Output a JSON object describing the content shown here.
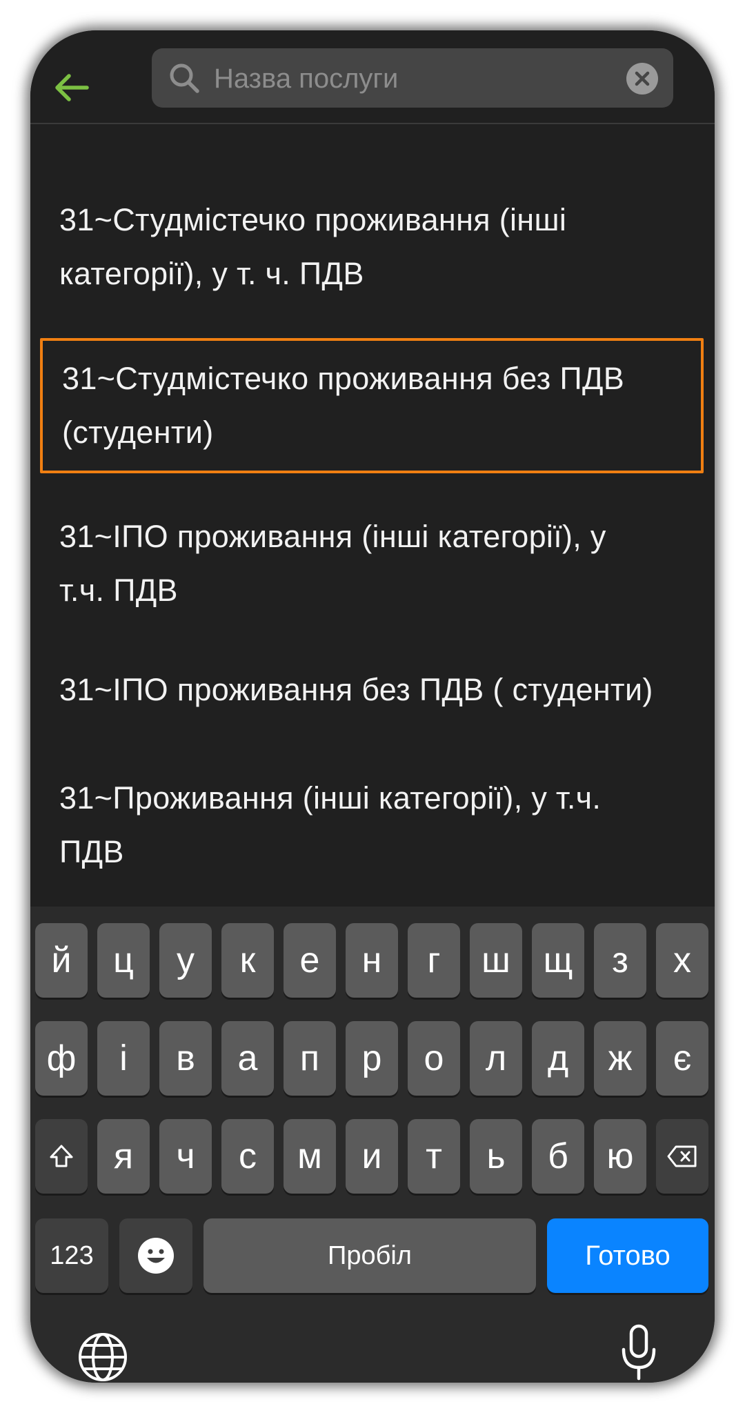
{
  "header": {
    "back_icon": "arrow-left-icon",
    "accent_color": "#7cc043",
    "search": {
      "placeholder": "Назва послуги",
      "value": ""
    }
  },
  "results": [
    {
      "line1": "31~Студмістечко проживання (інші",
      "line2": "категорії), у т. ч. ПДВ",
      "selected": false
    },
    {
      "line1": "31~Студмістечко проживання без ПДВ",
      "line2": "(студенти)",
      "selected": true
    },
    {
      "line1": "31~ІПО проживання (інші категорії), у",
      "line2": "т.ч. ПДВ",
      "selected": false
    },
    {
      "line1": "31~ІПО проживання без ПДВ ( студенти)",
      "line2": "",
      "selected": false
    },
    {
      "line1": "31~Проживання (інші категорії), у т.ч.",
      "line2": "ПДВ",
      "selected": false
    }
  ],
  "highlight_color": "#f07f12",
  "keyboard": {
    "row1": [
      "й",
      "ц",
      "у",
      "к",
      "е",
      "н",
      "г",
      "ш",
      "щ",
      "з",
      "х"
    ],
    "row2": [
      "ф",
      "і",
      "в",
      "а",
      "п",
      "р",
      "о",
      "л",
      "д",
      "ж",
      "є"
    ],
    "row3": [
      "я",
      "ч",
      "с",
      "м",
      "и",
      "т",
      "ь",
      "б",
      "ю"
    ],
    "numbers_label": "123",
    "space_label": "Пробіл",
    "done_label": "Готово",
    "done_color": "#0a84ff"
  }
}
